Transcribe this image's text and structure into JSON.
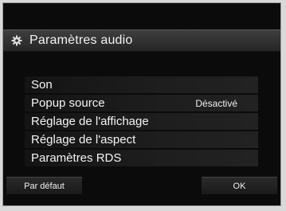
{
  "header": {
    "title": "Paramètres audio",
    "icon": "gear-icon"
  },
  "menu": {
    "items": [
      {
        "label": "Son",
        "value": ""
      },
      {
        "label": "Popup source",
        "value": "Désactivé"
      },
      {
        "label": "Réglage de l'affichage",
        "value": ""
      },
      {
        "label": "Réglage de l'aspect",
        "value": ""
      },
      {
        "label": "Paramètres RDS",
        "value": ""
      }
    ]
  },
  "footer": {
    "default_label": "Par défaut",
    "ok_label": "OK"
  }
}
